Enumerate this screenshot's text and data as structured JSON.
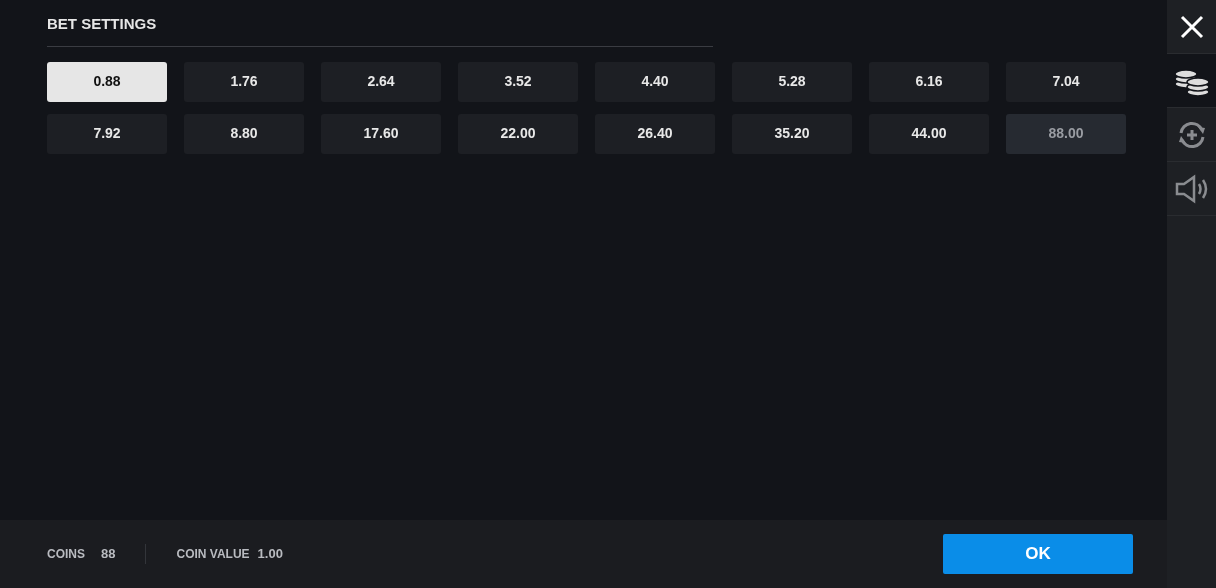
{
  "title": "BET SETTINGS",
  "bets": [
    {
      "label": "0.88",
      "selected": true,
      "disabled": false
    },
    {
      "label": "1.76",
      "selected": false,
      "disabled": false
    },
    {
      "label": "2.64",
      "selected": false,
      "disabled": false
    },
    {
      "label": "3.52",
      "selected": false,
      "disabled": false
    },
    {
      "label": "4.40",
      "selected": false,
      "disabled": false
    },
    {
      "label": "5.28",
      "selected": false,
      "disabled": false
    },
    {
      "label": "6.16",
      "selected": false,
      "disabled": false
    },
    {
      "label": "7.04",
      "selected": false,
      "disabled": false
    },
    {
      "label": "7.92",
      "selected": false,
      "disabled": false
    },
    {
      "label": "8.80",
      "selected": false,
      "disabled": false
    },
    {
      "label": "17.60",
      "selected": false,
      "disabled": false
    },
    {
      "label": "22.00",
      "selected": false,
      "disabled": false
    },
    {
      "label": "26.40",
      "selected": false,
      "disabled": false
    },
    {
      "label": "35.20",
      "selected": false,
      "disabled": false
    },
    {
      "label": "44.00",
      "selected": false,
      "disabled": false
    },
    {
      "label": "88.00",
      "selected": false,
      "disabled": true
    }
  ],
  "footer": {
    "coins_label": "COINS",
    "coins": "88",
    "coin_value_label": "COIN VALUE",
    "coin_value": "1.00",
    "ok": "OK"
  },
  "sidebar": [
    {
      "kind": "close",
      "selected": false
    },
    {
      "kind": "coins",
      "selected": true
    },
    {
      "kind": "autoplay",
      "selected": false
    },
    {
      "kind": "sound",
      "selected": false
    }
  ]
}
